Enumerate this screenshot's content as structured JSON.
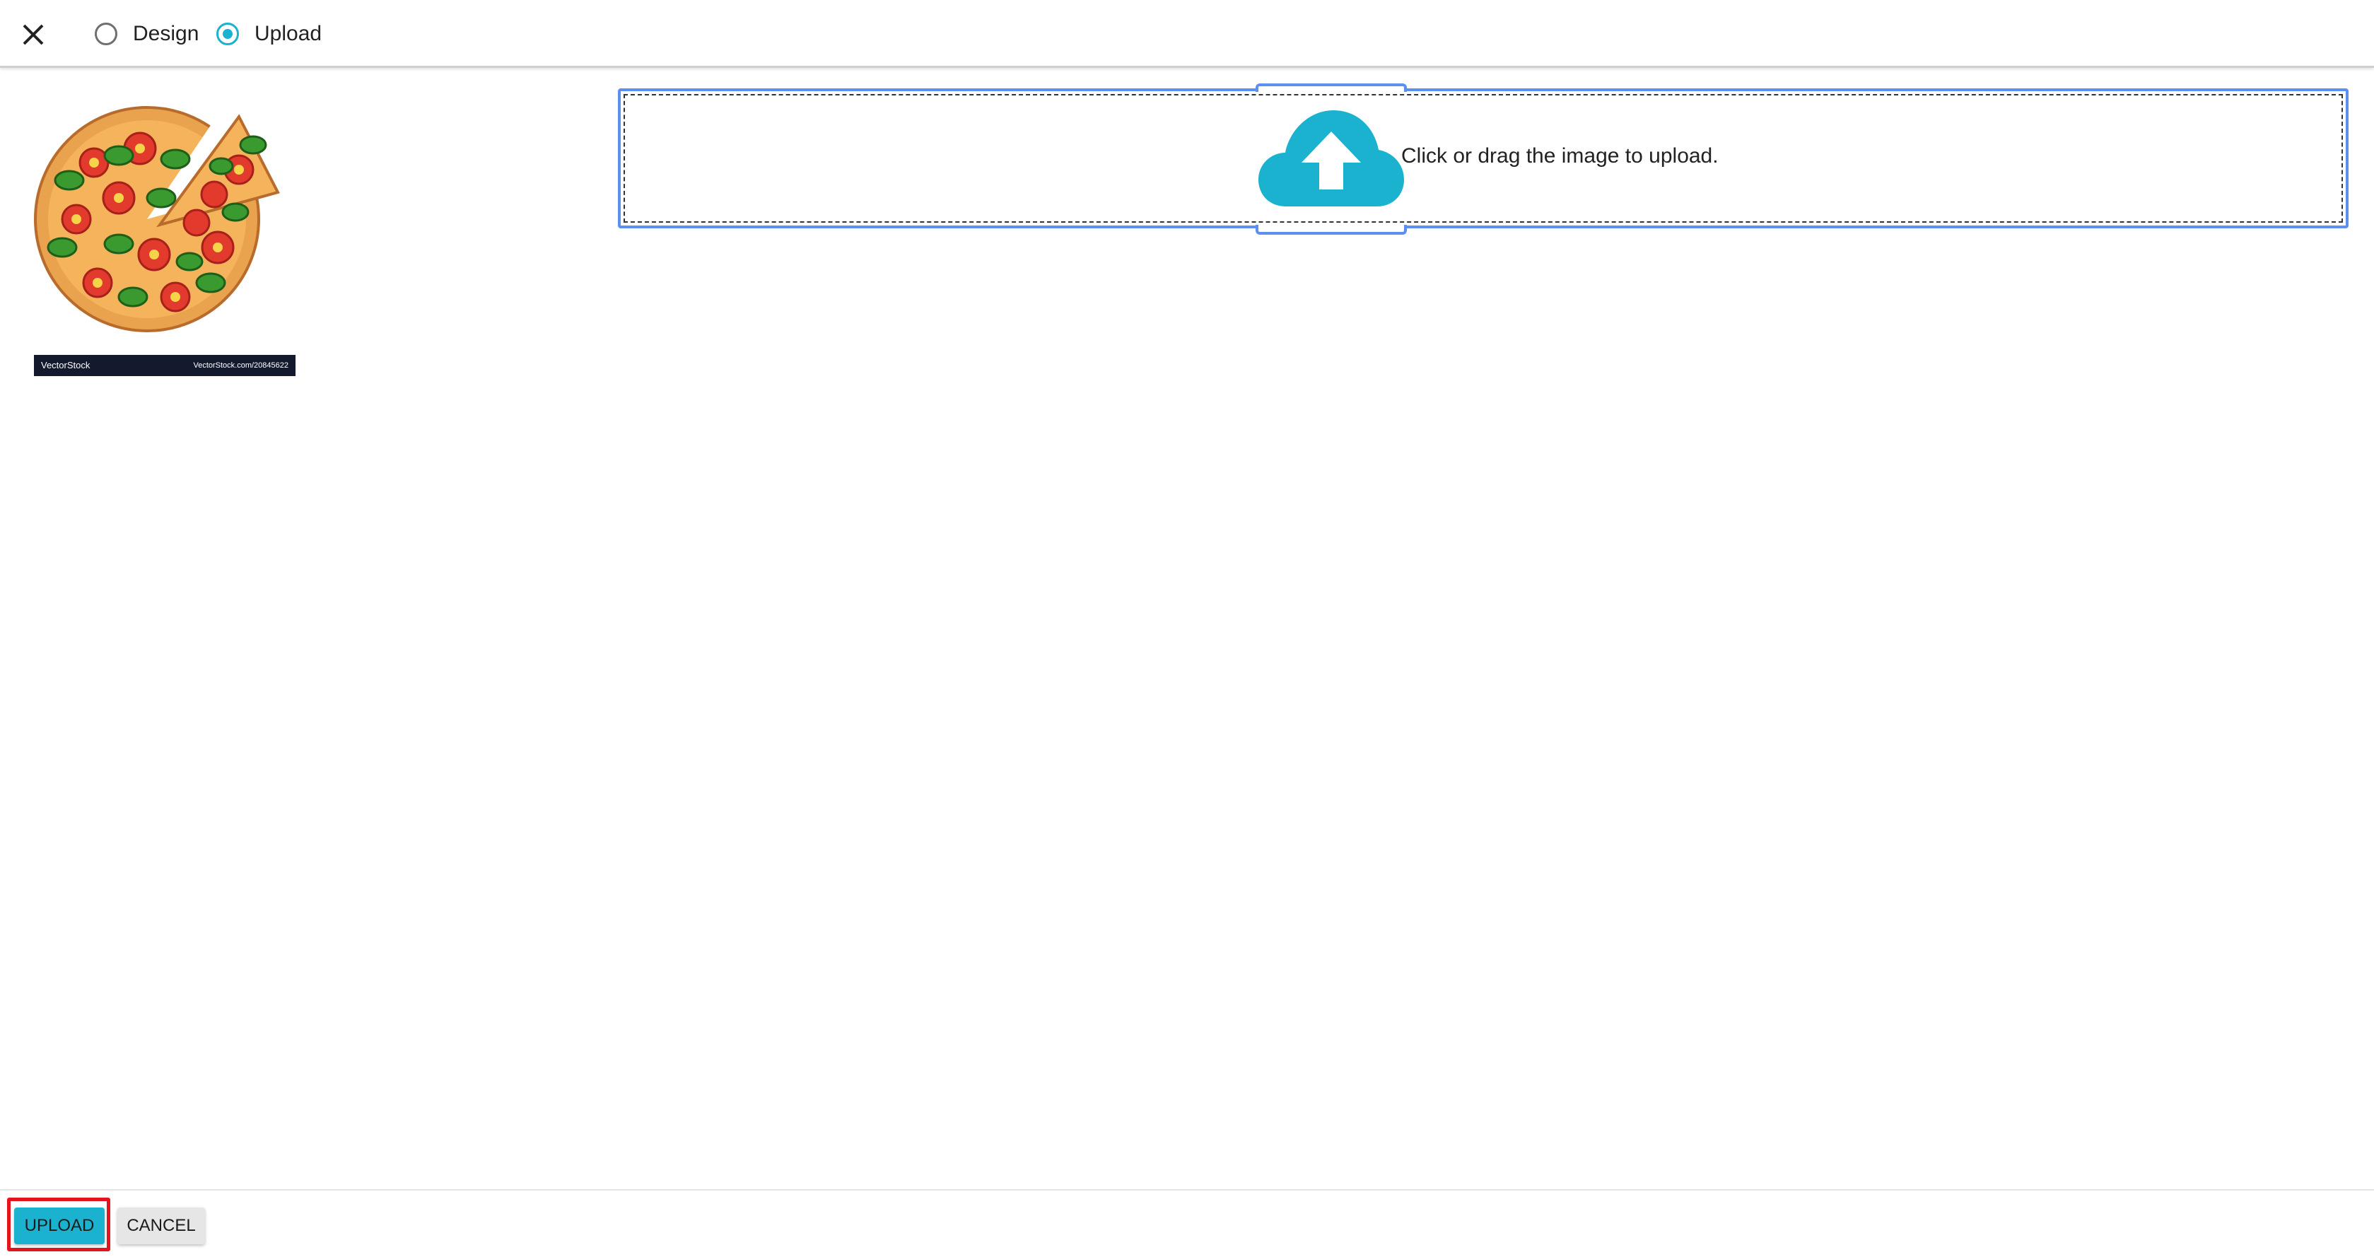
{
  "header": {
    "close_icon": "close-icon",
    "radio_options": [
      {
        "label": "Design",
        "checked": false
      },
      {
        "label": "Upload",
        "checked": true
      }
    ]
  },
  "thumbnail": {
    "subject": "pizza illustration",
    "banner_brand": "VectorStock",
    "banner_id": "VectorStock.com/20845622"
  },
  "dropzone": {
    "icon": "cloud-upload-icon",
    "text": "Click or drag the image to upload."
  },
  "footer": {
    "upload_label": "UPLOAD",
    "cancel_label": "CANCEL"
  },
  "colors": {
    "accent": "#1ab2cf",
    "focus_border": "#5b8ff0",
    "highlight": "#e3141c"
  }
}
